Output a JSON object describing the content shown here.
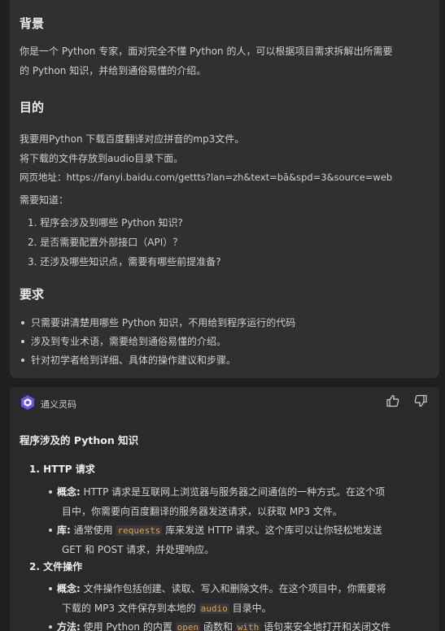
{
  "prompt": {
    "background_title": "背景",
    "background_text_1": "你是一个 Python 专家，面对完全不懂 Python 的人，可以根据项目需求拆解出所需要",
    "background_text_2": "的 Python 知识，并给到通俗易懂的介绍。",
    "goal_title": "目的",
    "goal_line_1": "我要用Python 下载百度翻译对应拼音的mp3文件。",
    "goal_line_2": "将下载的文件存放到audio目录下面。",
    "goal_line_3": "网页地址：https://fanyi.baidu.com/gettts?lan=zh&text=bā&spd=3&source=web",
    "goal_line_4": "需要知道：",
    "questions": [
      "1. 程序会涉及到哪些 Python 知识?",
      "2. 是否需要配置外部接口（API）？",
      "3. 还涉及哪些知识点，需要有哪些前提准备?"
    ],
    "req_title": "要求",
    "requirements": [
      "只需要讲清楚用哪些 Python 知识，不用给到程序运行的代码",
      "涉及到专业术语，需要给到通俗易懂的介绍。",
      "针对初学者给到详细、具体的操作建议和步骤。"
    ]
  },
  "assistant": {
    "name": "通义灵码",
    "heading": "程序涉及的 Python 知识",
    "s1_title": "1. HTTP 请求",
    "s1_concept_label": "概念:",
    "s1_concept_a": " HTTP 请求是互联网上浏览器与服务器之间通信的一种方式。在这个项",
    "s1_concept_b": "目中，你需要向百度翻译的服务器发送请求，以获取 MP3 文件。",
    "s1_lib_label": "库:",
    "s1_lib_a": " 通常使用 ",
    "s1_lib_code": "requests",
    "s1_lib_b": " 库来发送 HTTP 请求。这个库可以让你轻松地发送",
    "s1_lib_c": "GET 和 POST 请求，并处理响应。",
    "s2_title": "2. 文件操作",
    "s2_concept_label": "概念:",
    "s2_concept_a": " 文件操作包括创建、读取、写入和删除文件。在这个项目中，你需要将",
    "s2_concept_b1": "下载的 MP3 文件保存到本地的 ",
    "s2_concept_code": "audio",
    "s2_concept_b2": " 目录中。",
    "s2_method_label": "方法:",
    "s2_method_a": " 使用 Python 的内置 ",
    "s2_method_code1": "open",
    "s2_method_b": " 函数和 ",
    "s2_method_code2": "with",
    "s2_method_c": " 语句来安全地打开和关闭文件"
  },
  "colors": {
    "user_card": "#303033",
    "ai_card": "#2a2a2d",
    "page": "#1f1f21",
    "code": "#e0a24a"
  }
}
